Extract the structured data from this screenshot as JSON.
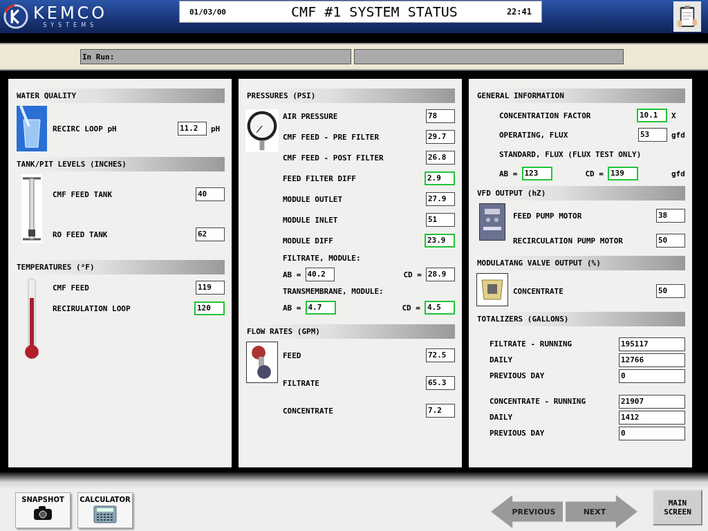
{
  "header": {
    "logo": {
      "name": "KEMCO",
      "sub": "SYSTEMS"
    },
    "date": "01/03/00",
    "title": "CMF #1 SYSTEM STATUS",
    "time": "22:41"
  },
  "status_bar": {
    "label": "In Run:"
  },
  "columns": [
    {
      "sections": [
        {
          "title": "WATER QUALITY",
          "kind": "glass",
          "rows": [
            {
              "kind": "field",
              "label": "RECIRC LOOP pH",
              "value": "11.2",
              "unit": "pH",
              "highlighted": false
            }
          ]
        },
        {
          "title": "TANK/PIT LEVELS (INCHES)",
          "kind": "sight-gauge",
          "rows": [
            {
              "kind": "field",
              "label": "CMF FEED TANK",
              "value": "40",
              "highlighted": false
            },
            {
              "kind": "field",
              "label": "RO FEED TANK",
              "value": "62",
              "highlighted": false
            }
          ]
        },
        {
          "title": "TEMPERATURES (°F)",
          "kind": "thermometer",
          "rows": [
            {
              "kind": "field",
              "label": "CMF FEED",
              "value": "119",
              "highlighted": false
            },
            {
              "kind": "field",
              "label": "RECIRULATION LOOP",
              "value": "120",
              "highlighted": true
            }
          ]
        }
      ]
    },
    {
      "sections": [
        {
          "title": "PRESSURES (PSI)",
          "kind": "pressure-gauge",
          "rows": [
            {
              "kind": "field",
              "label": "AIR PRESSURE",
              "value": "78",
              "highlighted": false
            },
            {
              "kind": "field",
              "label": "CMF FEED - PRE FILTER",
              "value": "29.7",
              "highlighted": false
            },
            {
              "kind": "field",
              "label": "CMF FEED - POST FILTER",
              "value": "26.8",
              "highlighted": false
            },
            {
              "kind": "field",
              "label": "FEED FILTER DIFF",
              "value": "2.9",
              "highlighted": true
            },
            {
              "kind": "field",
              "label": "MODULE OUTLET",
              "value": "27.9",
              "highlighted": false
            },
            {
              "kind": "field",
              "label": "MODULE INLET",
              "value": "51",
              "highlighted": false
            },
            {
              "kind": "field",
              "label": "MODULE DIFF",
              "value": "23.9",
              "highlighted": true
            },
            {
              "kind": "heading",
              "label": "FILTRATE, MODULE:"
            },
            {
              "kind": "pair",
              "items": [
                {
                  "label": "AB =",
                  "value": "40.2",
                  "highlighted": false
                },
                {
                  "label": "CD =",
                  "value": "28.9",
                  "highlighted": false
                }
              ]
            },
            {
              "kind": "heading",
              "label": "TRANSMEMBRANE, MODULE:"
            },
            {
              "kind": "pair",
              "items": [
                {
                  "label": "AB =",
                  "value": "4.7",
                  "highlighted": true
                },
                {
                  "label": "CD =",
                  "value": "4.5",
                  "highlighted": true
                }
              ]
            }
          ]
        },
        {
          "title": "FLOW RATES (GPM)",
          "kind": "flowmeter",
          "rows": [
            {
              "kind": "field",
              "label": "FEED",
              "value": "72.5",
              "highlighted": false
            },
            {
              "kind": "field",
              "label": "FILTRATE",
              "value": "65.3",
              "highlighted": false
            },
            {
              "kind": "field",
              "label": "CONCENTRATE",
              "value": "7.2",
              "highlighted": false
            }
          ]
        }
      ]
    },
    {
      "sections": [
        {
          "title": "GENERAL INFORMATION",
          "kind": "plain",
          "rows": [
            {
              "kind": "field",
              "label": "CONCENTRATION FACTOR",
              "value": "10.1",
              "unit": "X",
              "highlighted": true
            },
            {
              "kind": "field",
              "label": "OPERATING, FLUX",
              "value": "53",
              "unit": "gfd",
              "highlighted": false
            },
            {
              "kind": "heading",
              "label": "STANDARD, FLUX (FLUX TEST ONLY)"
            },
            {
              "kind": "pair",
              "unit": "gfd",
              "items": [
                {
                  "label": "AB =",
                  "value": "123",
                  "highlighted": true
                },
                {
                  "label": "CD =",
                  "value": "139",
                  "highlighted": true
                }
              ]
            }
          ]
        },
        {
          "title": "VFD OUTPUT (hZ)",
          "kind": "drive",
          "rows": [
            {
              "kind": "field",
              "label": "FEED PUMP MOTOR",
              "value": "38",
              "highlighted": false
            },
            {
              "kind": "field",
              "label": "RECIRCULATION PUMP MOTOR",
              "value": "50",
              "highlighted": false
            }
          ]
        },
        {
          "title": "MODULATANG VALVE OUTPUT (%)",
          "kind": "valve",
          "rows": [
            {
              "kind": "field",
              "label": "CONCENTRATE",
              "value": "50",
              "highlighted": false
            }
          ]
        },
        {
          "title": "TOTALIZERS (GALLONS)",
          "kind": "plain",
          "rows": [
            {
              "kind": "total",
              "label": "FILTRATE - RUNNING",
              "value": "195117",
              "highlighted": false
            },
            {
              "kind": "total",
              "label": "DAILY",
              "value": "12766",
              "highlighted": false
            },
            {
              "kind": "total",
              "label": "PREVIOUS DAY",
              "value": "0",
              "highlighted": false
            },
            {
              "kind": "total",
              "label": "CONCENTRATE - RUNNING",
              "value": "21907",
              "highlighted": false
            },
            {
              "kind": "total",
              "label": "DAILY",
              "value": "1412",
              "highlighted": false
            },
            {
              "kind": "total",
              "label": "PREVIOUS DAY",
              "value": "0",
              "highlighted": false
            }
          ]
        }
      ]
    }
  ],
  "footer": {
    "left_buttons": [
      {
        "label": "SNAPSHOT",
        "kind": "camera"
      },
      {
        "label": "CALCULATOR",
        "kind": "calculator"
      }
    ],
    "nav": [
      {
        "label": "PREVIOUS",
        "kind": "back"
      },
      {
        "label": "NEXT",
        "kind": "forward"
      }
    ],
    "main_button": "MAIN SCREEN"
  }
}
